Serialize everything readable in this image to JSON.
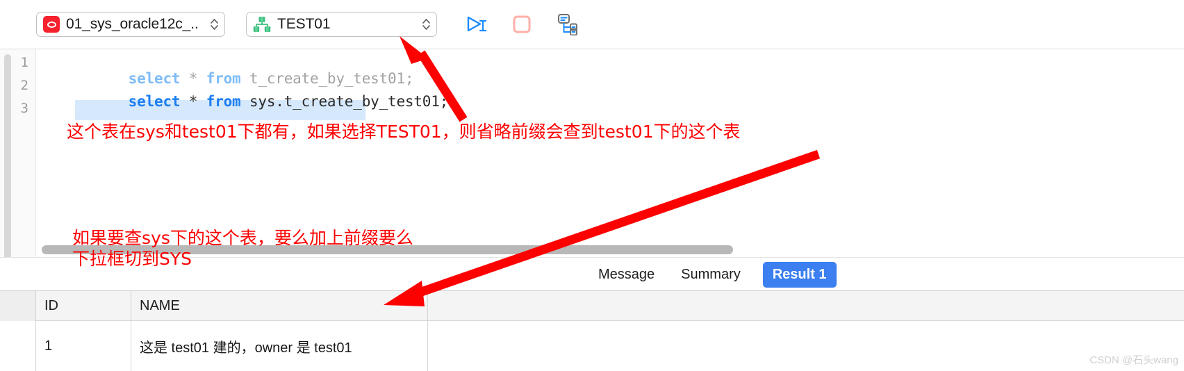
{
  "toolbar": {
    "connection": {
      "label": "01_sys_oracle12c_..",
      "icon": "database-icon",
      "stepper_icon": "stepper-up-down-icon"
    },
    "schema": {
      "label": "TEST01",
      "icon": "schema-tree-icon",
      "stepper_icon": "stepper-up-down-icon"
    },
    "buttons": [
      {
        "name": "run-query-button",
        "icon": "play-cursor-icon",
        "color": "#1a8cff"
      },
      {
        "name": "stop-query-button",
        "icon": "stop-square-icon",
        "color": "#ffb0a8"
      },
      {
        "name": "explain-plan-button",
        "icon": "execution-plan-icon",
        "color": "#1a8cff"
      }
    ]
  },
  "editor": {
    "line_numbers": [
      "1",
      "2",
      "3"
    ],
    "lines": [
      {
        "number": "1",
        "selected": true,
        "tokens": [
          {
            "t": "select",
            "c": "kw-dim"
          },
          {
            "t": " ",
            "c": "op-dim"
          },
          {
            "t": "*",
            "c": "op-dim"
          },
          {
            "t": " ",
            "c": "op-dim"
          },
          {
            "t": "from",
            "c": "kw-dim"
          },
          {
            "t": " ",
            "c": "op-dim"
          },
          {
            "t": "t_create_by_test01;",
            "c": "idt-dim"
          }
        ],
        "text": "select * from t_create_by_test01;"
      },
      {
        "number": "2",
        "selected": false,
        "tokens": [
          {
            "t": "select",
            "c": "kw"
          },
          {
            "t": " ",
            "c": "op"
          },
          {
            "t": "*",
            "c": "op"
          },
          {
            "t": " ",
            "c": "op"
          },
          {
            "t": "from",
            "c": "kw"
          },
          {
            "t": " ",
            "c": "op"
          },
          {
            "t": "sys.t_create_by_test01;",
            "c": "idt"
          }
        ],
        "text": "select * from sys.t_create_by_test01;"
      },
      {
        "number": "3",
        "selected": false,
        "tokens": [],
        "text": ""
      }
    ]
  },
  "results": {
    "tabs": [
      {
        "label": "Message",
        "active": false
      },
      {
        "label": "Summary",
        "active": false
      },
      {
        "label": "Result 1",
        "active": true
      }
    ],
    "columns": [
      "ID",
      "NAME"
    ],
    "rows": [
      {
        "ID": "1",
        "NAME": "这是 test01 建的，owner 是 test01"
      }
    ]
  },
  "annotations": [
    {
      "name": "annotation-schema-note",
      "text": "这个表在sys和test01下都有，如果选择TEST01，则省略前缀会查到test01下的这个表"
    },
    {
      "name": "annotation-sys-note-line1",
      "text": "如果要查sys下的这个表，要么加上前缀要么"
    },
    {
      "name": "annotation-sys-note-line2",
      "text": "下拉框切到SYS"
    }
  ],
  "arrows": [
    {
      "name": "arrow-to-schema-combo"
    },
    {
      "name": "arrow-to-result-row"
    }
  ],
  "watermark": {
    "text": "CSDN @石头wang"
  },
  "colors": {
    "accent_blue": "#3b7ff0",
    "annotation_red": "#fd0000",
    "db_red": "#f5222d",
    "schema_green": "#3dbd7d",
    "selection_blue": "#d6e8fb"
  }
}
